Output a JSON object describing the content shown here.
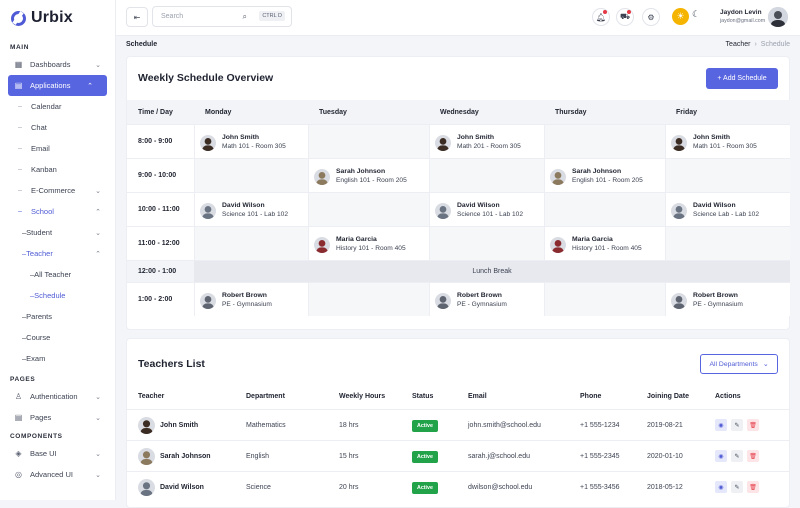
{
  "brand": {
    "name": "Urbix"
  },
  "sidebar": {
    "main_label": "MAIN",
    "pages_label": "PAGES",
    "components_label": "COMPONENTS",
    "items": [
      {
        "label": "Dashboards",
        "icon": "dashboard-icon"
      },
      {
        "label": "Applications",
        "icon": "apps-icon"
      },
      {
        "label": "Calendar"
      },
      {
        "label": "Chat"
      },
      {
        "label": "Email"
      },
      {
        "label": "Kanban"
      },
      {
        "label": "E-Commerce"
      },
      {
        "label": "School"
      },
      {
        "label": "Student"
      },
      {
        "label": "Teacher"
      },
      {
        "label": "All Teacher"
      },
      {
        "label": "Schedule"
      },
      {
        "label": "Parents"
      },
      {
        "label": "Course"
      },
      {
        "label": "Exam"
      },
      {
        "label": "Authentication",
        "icon": "user-icon"
      },
      {
        "label": "Pages",
        "icon": "pages-icon"
      },
      {
        "label": "Base UI",
        "icon": "layers-icon"
      },
      {
        "label": "Advanced UI",
        "icon": "advanced-icon"
      }
    ]
  },
  "topbar": {
    "search_placeholder": "Search",
    "shortcut": "CTRL D",
    "user_name": "Jaydon Levin",
    "user_email": "jaydon@gmail.com"
  },
  "breadcrumb": {
    "title": "Schedule",
    "parent": "Teacher",
    "current": "Schedule"
  },
  "schedule": {
    "title": "Weekly Schedule Overview",
    "add_label": "+ Add Schedule",
    "head": [
      "Time / Day",
      "Monday",
      "Tuesday",
      "Wednesday",
      "Thursday",
      "Friday"
    ],
    "rows": [
      {
        "time": "8:00 - 9:00",
        "cells": [
          {
            "name": "John Smith",
            "cls": "Math 101 - Room 305",
            "c": "#3b2c23"
          },
          null,
          {
            "name": "John Smith",
            "cls": "Math 201 - Room 305",
            "c": "#3b2c23"
          },
          null,
          {
            "name": "John Smith",
            "cls": "Math 101 - Room 305",
            "c": "#3b2c23"
          }
        ]
      },
      {
        "time": "9:00 - 10:00",
        "cells": [
          null,
          {
            "name": "Sarah Johnson",
            "cls": "English 101 - Room 205",
            "c": "#8c7a5e"
          },
          null,
          {
            "name": "Sarah Johnson",
            "cls": "English 101 - Room 205",
            "c": "#8c7a5e"
          },
          null
        ]
      },
      {
        "time": "10:00 - 11:00",
        "cells": [
          {
            "name": "David Wilson",
            "cls": "Science 101 - Lab 102",
            "c": "#6a7382"
          },
          null,
          {
            "name": "David Wilson",
            "cls": "Science 101 - Lab 102",
            "c": "#6a7382"
          },
          null,
          {
            "name": "David Wilson",
            "cls": "Science Lab - Lab 102",
            "c": "#6a7382"
          }
        ]
      },
      {
        "time": "11:00 - 12:00",
        "cells": [
          null,
          {
            "name": "Maria Garcia",
            "cls": "History 101 - Room 405",
            "c": "#8a2b2f"
          },
          null,
          {
            "name": "Maria Garcia",
            "cls": "History 101 - Room 405",
            "c": "#8a2b2f"
          },
          null
        ]
      }
    ],
    "lunch_time": "12:00 - 1:00",
    "lunch_label": "Lunch Break",
    "last_row": {
      "time": "1:00 - 2:00",
      "cells": [
        {
          "name": "Robert Brown",
          "cls": "PE - Gymnasium",
          "c": "#5e6470"
        },
        null,
        {
          "name": "Robert Brown",
          "cls": "PE - Gymnasium",
          "c": "#5e6470"
        },
        null,
        {
          "name": "Robert Brown",
          "cls": "PE - Gymnasium",
          "c": "#5e6470"
        }
      ]
    }
  },
  "teachers": {
    "title": "Teachers List",
    "filter_label": "All Departments",
    "columns": [
      "Teacher",
      "Department",
      "Weekly Hours",
      "Status",
      "Email",
      "Phone",
      "Joining Date",
      "Actions"
    ],
    "rows": [
      {
        "name": "John Smith",
        "dept": "Mathematics",
        "hours": "18 hrs",
        "status": "Active",
        "email": "john.smith@school.edu",
        "phone": "+1 555-1234",
        "date": "2019-08-21",
        "c": "#3b2c23"
      },
      {
        "name": "Sarah Johnson",
        "dept": "English",
        "hours": "15 hrs",
        "status": "Active",
        "email": "sarah.j@school.edu",
        "phone": "+1 555-2345",
        "date": "2020-01-10",
        "c": "#8c7a5e"
      },
      {
        "name": "David Wilson",
        "dept": "Science",
        "hours": "20 hrs",
        "status": "Active",
        "email": "dwilson@school.edu",
        "phone": "+1 555-3456",
        "date": "2018-05-12",
        "c": "#6a7382"
      }
    ]
  }
}
